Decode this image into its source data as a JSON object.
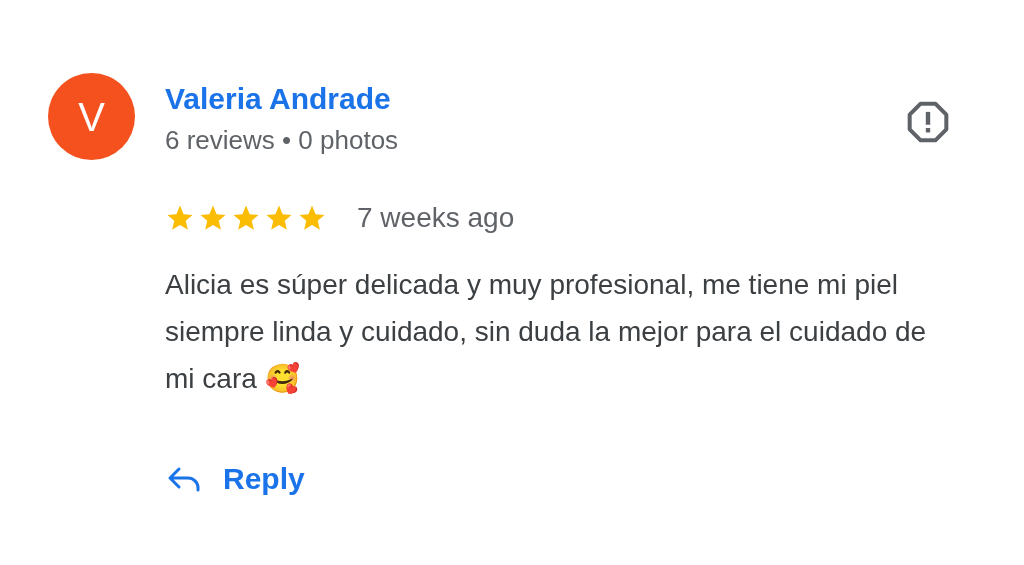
{
  "reviewer": {
    "initial": "V",
    "color": "#f4511e",
    "name": "Valeria Andrade",
    "meta": "6 reviews • 0 photos"
  },
  "review": {
    "stars": 5,
    "time": "7 weeks ago",
    "text": "Alicia es súper delicada y muy profesional, me tiene mi piel siempre linda y cuidado, sin duda la mejor para el cuidado de mi cara 🥰"
  },
  "reply": {
    "label": "Reply"
  }
}
